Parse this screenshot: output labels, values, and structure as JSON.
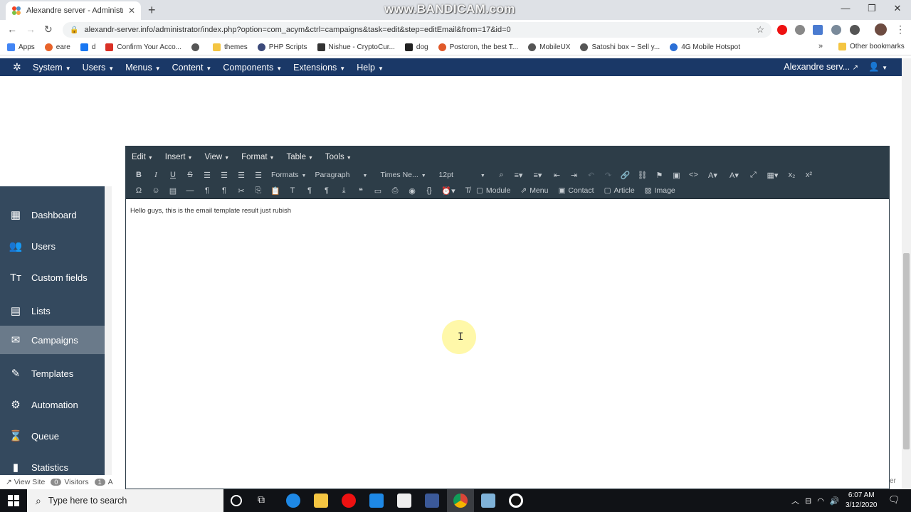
{
  "browser": {
    "tab_title": "Alexandre server - Administratio",
    "tab_close": "✕",
    "new_tab": "+",
    "watermark": "www.BANDICAM.com",
    "url": "alexandr-server.info/administrator/index.php?option=com_acym&ctrl=campaigns&task=edit&step=editEmail&from=17&id=0",
    "bookmarks": [
      {
        "label": "Apps",
        "color": "#4285f4"
      },
      {
        "label": "eare",
        "color": "#e8632a"
      },
      {
        "label": "d",
        "color": "#1877f2"
      },
      {
        "label": "Confirm Your Acco...",
        "color": "#d93025"
      },
      {
        "label": "",
        "color": "#555555"
      },
      {
        "label": "themes",
        "color": "#f4c542"
      },
      {
        "label": "PHP Scripts",
        "color": "#3c4a7a"
      },
      {
        "label": "Nishue - CryptoCur...",
        "color": "#333333"
      },
      {
        "label": "dog",
        "color": "#222222"
      },
      {
        "label": "Postcron, the best T...",
        "color": "#e0592a"
      },
      {
        "label": "MobileUX",
        "color": "#555555"
      },
      {
        "label": "Satoshi box ~ Sell y...",
        "color": "#555555"
      },
      {
        "label": "4G Mobile Hotspot",
        "color": "#2b6fd6"
      }
    ],
    "other_bookmarks": "Other bookmarks"
  },
  "admin": {
    "menu": [
      "System",
      "Users",
      "Menus",
      "Content",
      "Components",
      "Extensions",
      "Help"
    ],
    "site_name": "Alexandre serv...",
    "accent": "#1a3867"
  },
  "sidebar": {
    "items": [
      {
        "label": "Dashboard",
        "icon": "▦"
      },
      {
        "label": "Users",
        "icon": "👥"
      },
      {
        "label": "Custom fields",
        "icon": "Tт"
      },
      {
        "label": "Lists",
        "icon": "▤"
      },
      {
        "label": "Campaigns",
        "icon": "✉"
      },
      {
        "label": "Templates",
        "icon": "✎"
      },
      {
        "label": "Automation",
        "icon": "⚙"
      },
      {
        "label": "Queue",
        "icon": "⌛"
      },
      {
        "label": "Statistics",
        "icon": "▮"
      }
    ],
    "active": "Campaigns"
  },
  "editor": {
    "menus": [
      "Edit",
      "Insert",
      "View",
      "Format",
      "Table",
      "Tools"
    ],
    "formats": "Formats",
    "block": "Paragraph",
    "font": "Times Ne...",
    "size": "12pt",
    "insert_buttons": [
      "Module",
      "Menu",
      "Contact",
      "Article",
      "Image"
    ],
    "content": "Hello guys, this is the email template result just rubish"
  },
  "statusbar": {
    "view_site": "View Site",
    "visitors_count": "0",
    "visitors_label": "Visitors",
    "admins_count": "1",
    "admins_label": "A",
    "right_text": "er"
  },
  "taskbar": {
    "search_placeholder": "Type here to search",
    "time": "6:07 AM",
    "date": "3/12/2020"
  }
}
